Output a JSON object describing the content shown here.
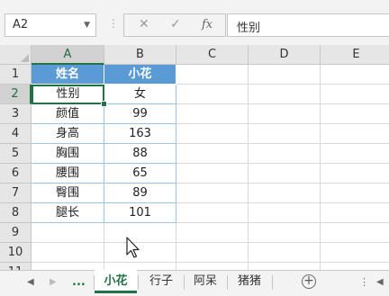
{
  "formula_bar": {
    "name_box": "A2",
    "cancel_icon": "✕",
    "enter_icon": "✓",
    "fx_label": "fx",
    "formula_value": "性别"
  },
  "columns": [
    "A",
    "B",
    "C",
    "D",
    "E"
  ],
  "rows": [
    "1",
    "2",
    "3",
    "4",
    "5",
    "6",
    "7",
    "8",
    "9",
    "10",
    "11"
  ],
  "table": {
    "headers": [
      "姓名",
      "小花"
    ],
    "rows": [
      [
        "性别",
        "女"
      ],
      [
        "颜值",
        "99"
      ],
      [
        "身高",
        "163"
      ],
      [
        "胸围",
        "88"
      ],
      [
        "腰围",
        "65"
      ],
      [
        "臀围",
        "89"
      ],
      [
        "腿长",
        "101"
      ]
    ]
  },
  "sheet_tabs": {
    "overflow": "...",
    "tabs": [
      "小花",
      "行子",
      "阿呆",
      "猪猪"
    ],
    "active": "小花",
    "add_icon": "+"
  },
  "colors": {
    "accent": "#217346",
    "table_header": "#5b9bd5",
    "table_border": "#9dc3e6"
  }
}
